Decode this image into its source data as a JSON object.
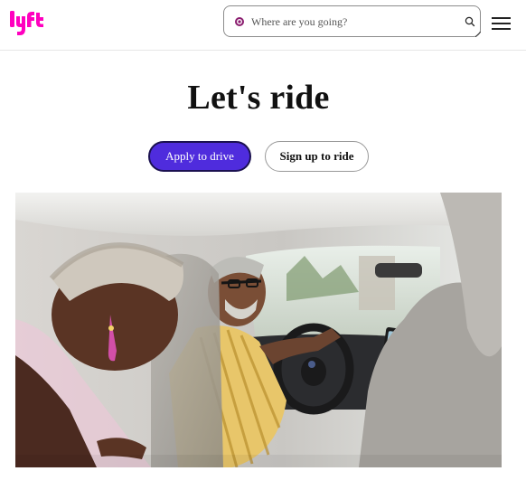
{
  "header": {
    "logo_text": "lyft",
    "search": {
      "placeholder": "Where are you going?",
      "value": "",
      "icon": "search-icon",
      "pin_icon": "location-dot-icon"
    },
    "menu_icon": "hamburger-menu-icon"
  },
  "hero": {
    "title": "Let's ride",
    "apply_button": "Apply to drive",
    "signup_button": "Sign up to ride"
  },
  "image": {
    "subject": "driver-and-passenger-photo"
  },
  "colors": {
    "brand_pink": "#ff00bf",
    "apply_button_bg": "#4f2cdd",
    "pin_purple": "#8a1c6e"
  }
}
